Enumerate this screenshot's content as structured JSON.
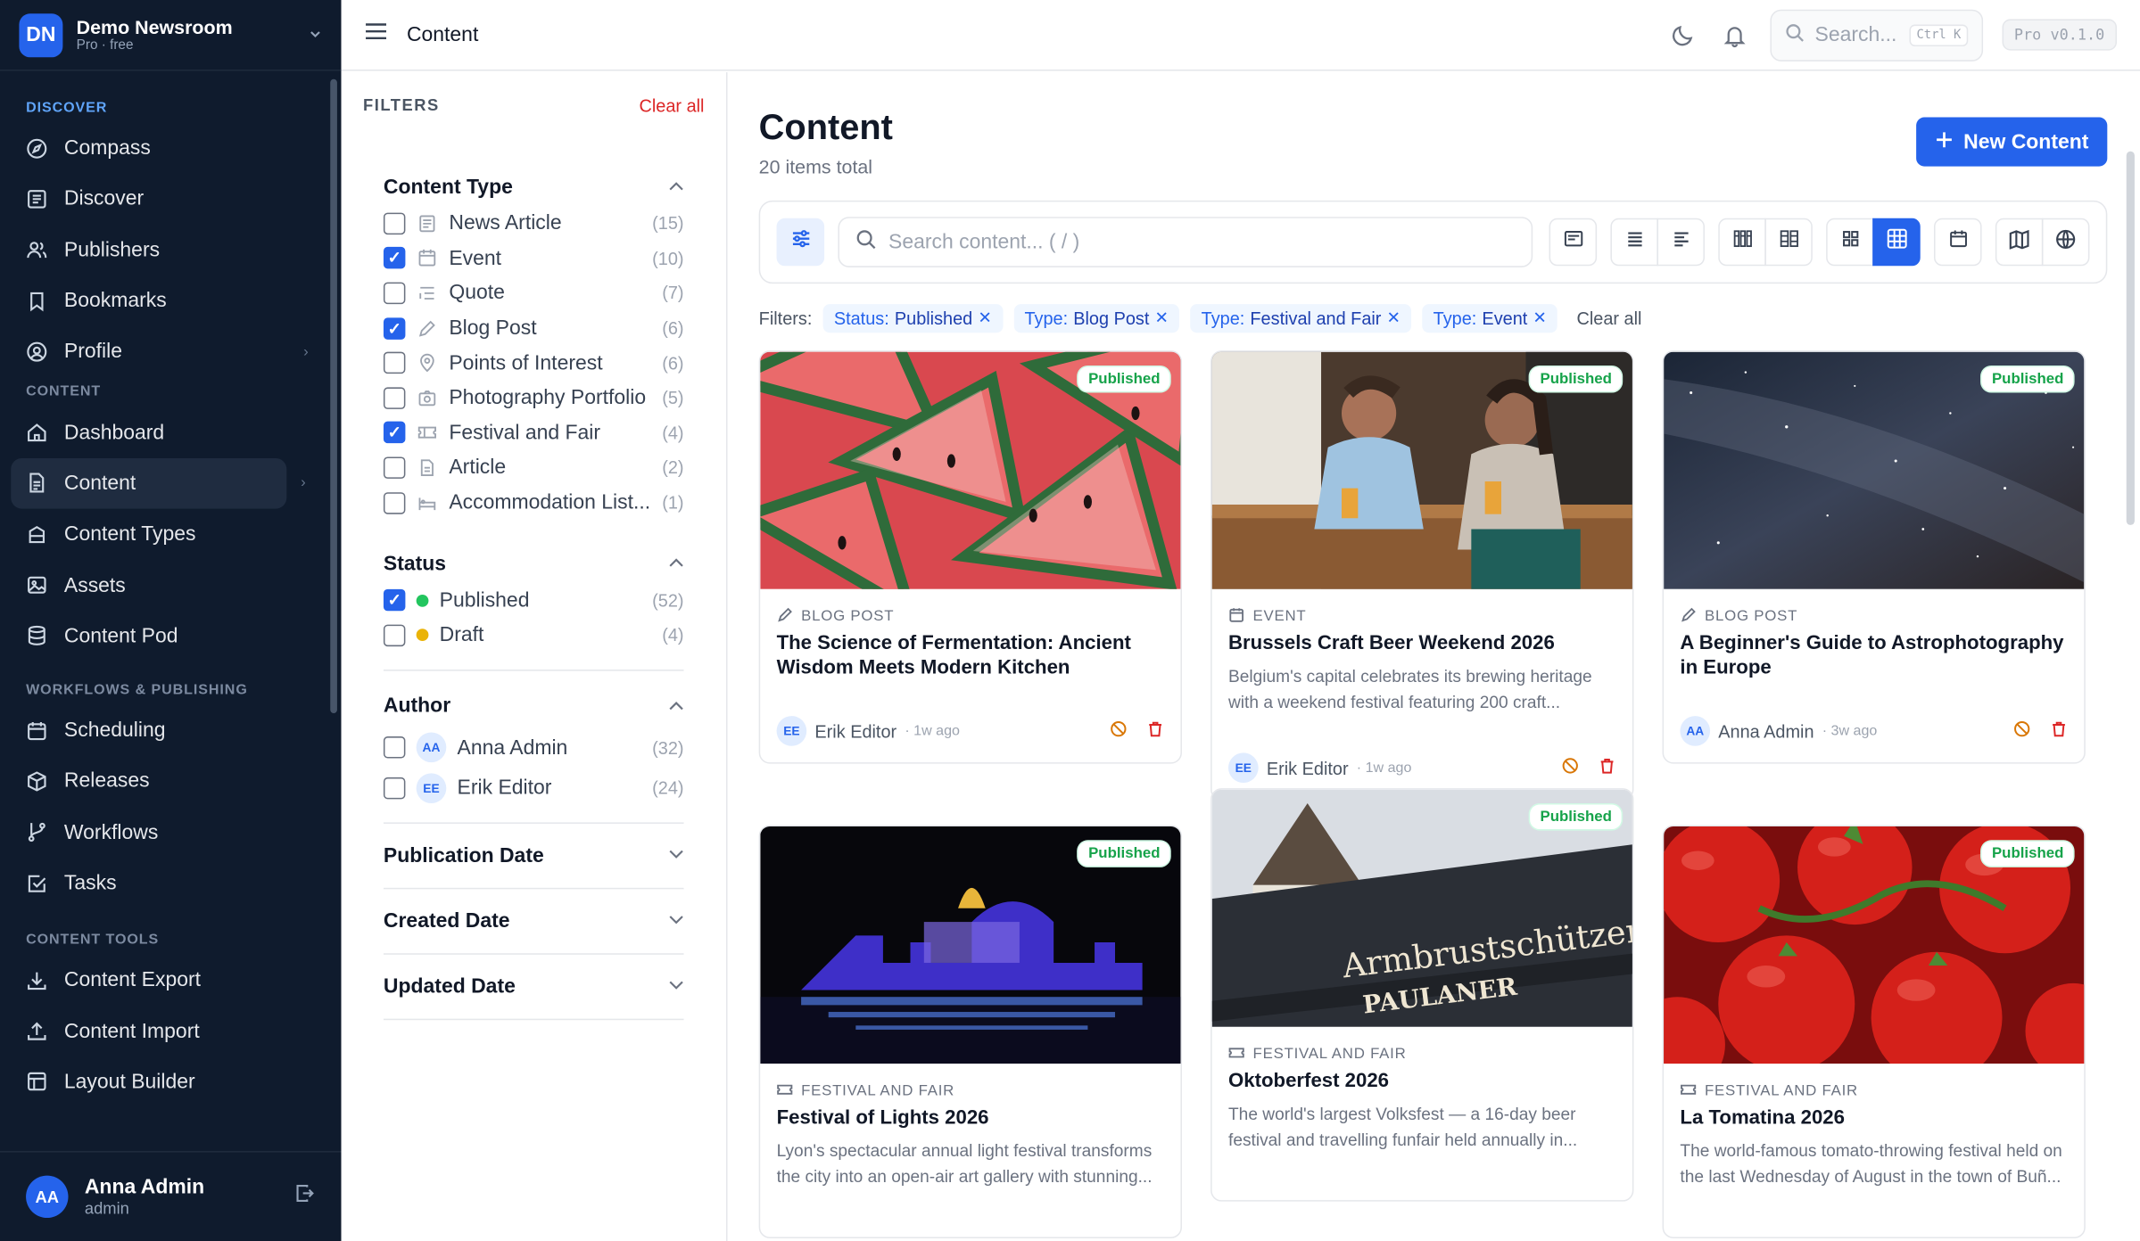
{
  "workspace": {
    "initials": "DN",
    "name": "Demo Newsroom",
    "plan": "Pro · free"
  },
  "nav": {
    "discover_title": "DISCOVER",
    "discover": [
      {
        "label": "Compass"
      },
      {
        "label": "Discover"
      },
      {
        "label": "Publishers"
      },
      {
        "label": "Bookmarks"
      },
      {
        "label": "Profile"
      }
    ],
    "content_title": "CONTENT",
    "content": [
      {
        "label": "Dashboard"
      },
      {
        "label": "Content"
      },
      {
        "label": "Content Types"
      },
      {
        "label": "Assets"
      },
      {
        "label": "Content Pod"
      }
    ],
    "workflow_title": "WORKFLOWS & PUBLISHING",
    "workflow": [
      {
        "label": "Scheduling"
      },
      {
        "label": "Releases"
      },
      {
        "label": "Workflows"
      },
      {
        "label": "Tasks"
      }
    ],
    "tools_title": "CONTENT TOOLS",
    "tools": [
      {
        "label": "Content Export"
      },
      {
        "label": "Content Import"
      },
      {
        "label": "Layout Builder"
      }
    ]
  },
  "user": {
    "initials": "AA",
    "name": "Anna Admin",
    "role": "admin"
  },
  "topbar": {
    "title": "Content",
    "search_placeholder": "Search...",
    "shortcut": "Ctrl K",
    "version": "Pro v0.1.0"
  },
  "filters": {
    "title": "FILTERS",
    "clear": "Clear all",
    "content_type": {
      "title": "Content Type",
      "items": [
        {
          "label": "News Article",
          "count": "(15)",
          "checked": false,
          "icon": "newspaper-icon"
        },
        {
          "label": "Event",
          "count": "(10)",
          "checked": true,
          "icon": "calendar-icon"
        },
        {
          "label": "Quote",
          "count": "(7)",
          "checked": false,
          "icon": "quote-icon"
        },
        {
          "label": "Blog Post",
          "count": "(6)",
          "checked": true,
          "icon": "pen-icon"
        },
        {
          "label": "Points of Interest",
          "count": "(6)",
          "checked": false,
          "icon": "map-pin-icon"
        },
        {
          "label": "Photography Portfolio",
          "count": "(5)",
          "checked": false,
          "icon": "camera-icon"
        },
        {
          "label": "Festival and Fair",
          "count": "(4)",
          "checked": true,
          "icon": "ticket-icon"
        },
        {
          "label": "Article",
          "count": "(2)",
          "checked": false,
          "icon": "document-icon"
        },
        {
          "label": "Accommodation List...",
          "count": "(1)",
          "checked": false,
          "icon": "bed-icon"
        }
      ]
    },
    "status": {
      "title": "Status",
      "items": [
        {
          "label": "Published",
          "count": "(52)",
          "checked": true,
          "color": "#22c55e"
        },
        {
          "label": "Draft",
          "count": "(4)",
          "checked": false,
          "color": "#eab308"
        }
      ]
    },
    "author": {
      "title": "Author",
      "items": [
        {
          "initials": "AA",
          "label": "Anna Admin",
          "count": "(32)",
          "checked": false
        },
        {
          "initials": "EE",
          "label": "Erik Editor",
          "count": "(24)",
          "checked": false
        }
      ]
    },
    "publication_date": "Publication Date",
    "created_date": "Created Date",
    "updated_date": "Updated Date"
  },
  "page": {
    "title": "Content",
    "subtitle": "20 items total",
    "new_button": "New Content",
    "search_placeholder": "Search content... ( / )"
  },
  "active_filters": {
    "label": "Filters:",
    "chips": [
      {
        "key": "Status:",
        "value": "Published"
      },
      {
        "key": "Type:",
        "value": "Blog Post"
      },
      {
        "key": "Type:",
        "value": "Festival and Fair"
      },
      {
        "key": "Type:",
        "value": "Event"
      }
    ],
    "clear": "Clear all"
  },
  "cards": [
    {
      "status": "Published",
      "type": "BLOG POST",
      "title": "The Science of Fermentation: Ancient Wisdom Meets Modern Kitchen",
      "desc": "",
      "author_initials": "EE",
      "author": "Erik Editor",
      "ago": "· 1w ago"
    },
    {
      "status": "Published",
      "type": "EVENT",
      "title": "Brussels Craft Beer Weekend 2026",
      "desc": "Belgium's capital celebrates its brewing heritage with a weekend festival featuring 200 craft...",
      "author_initials": "EE",
      "author": "Erik Editor",
      "ago": "· 1w ago"
    },
    {
      "status": "Published",
      "type": "BLOG POST",
      "title": "A Beginner's Guide to Astrophotography in Europe",
      "desc": "",
      "author_initials": "AA",
      "author": "Anna Admin",
      "ago": "· 3w ago"
    },
    {
      "status": "Published",
      "type": "FESTIVAL AND FAIR",
      "title": "Festival of Lights 2026",
      "desc": "Lyon's spectacular annual light festival transforms the city into an open-air art gallery with stunning...",
      "author_initials": "",
      "author": "",
      "ago": ""
    },
    {
      "status": "Published",
      "type": "FESTIVAL AND FAIR",
      "title": "Oktoberfest 2026",
      "desc": "The world's largest Volksfest — a 16-day beer festival and travelling funfair held annually in...",
      "author_initials": "",
      "author": "",
      "ago": "",
      "sign1": "Armbrustschützenzelt",
      "sign2": "PAULANER"
    },
    {
      "status": "Published",
      "type": "FESTIVAL AND FAIR",
      "title": "La Tomatina 2026",
      "desc": "The world-famous tomato-throwing festival held on the last Wednesday of August in the town of Buñ...",
      "author_initials": "",
      "author": "",
      "ago": ""
    }
  ]
}
